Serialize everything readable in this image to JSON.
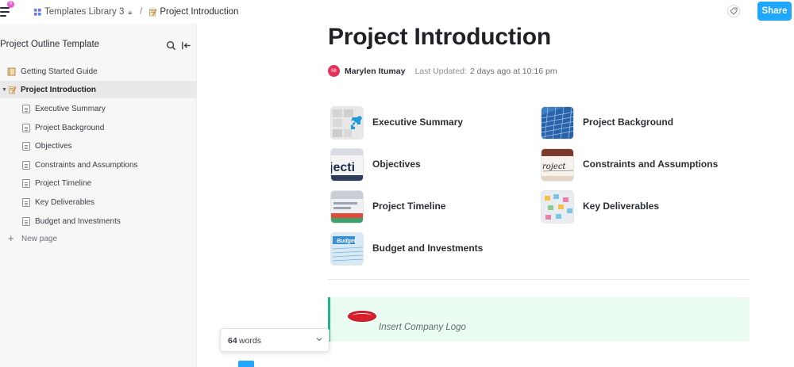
{
  "topbar": {
    "notification_count": "8",
    "breadcrumb": {
      "library_label": "Templates Library 3",
      "separator": "/",
      "page_label": "Project Introduction"
    },
    "share_label": "Share"
  },
  "sidebar": {
    "title": "Project Outline Template",
    "items": [
      {
        "label": "Getting Started Guide",
        "icon": "notebook-emoji-icon"
      },
      {
        "label": "Project Introduction",
        "icon": "memo-emoji-icon",
        "active": true
      },
      {
        "label": "Executive Summary",
        "icon": "doc-icon"
      },
      {
        "label": "Project Background",
        "icon": "doc-icon"
      },
      {
        "label": "Objectives",
        "icon": "doc-icon"
      },
      {
        "label": "Constraints and Assumptions",
        "icon": "doc-icon"
      },
      {
        "label": "Project Timeline",
        "icon": "doc-icon"
      },
      {
        "label": "Key Deliverables",
        "icon": "doc-icon"
      },
      {
        "label": "Budget and Investments",
        "icon": "doc-icon"
      }
    ],
    "new_page_label": "New page"
  },
  "main": {
    "title": "Project Introduction",
    "author": {
      "initials": "MI",
      "name": "Marylen Itumay",
      "updated_label": "Last Updated:",
      "updated_value": "2 days ago at 10:16 pm"
    },
    "cards": [
      {
        "label": "Executive Summary"
      },
      {
        "label": "Project Background"
      },
      {
        "label": "Objectives"
      },
      {
        "label": "Constraints and Assumptions"
      },
      {
        "label": "Project Timeline"
      },
      {
        "label": "Key Deliverables"
      },
      {
        "label": "Budget and Investments"
      }
    ],
    "thumb_text": {
      "objectives": "jecti",
      "constraints": "roject",
      "budget": "Budget"
    },
    "callout": {
      "logo_text": "Peterbilt",
      "text": "Insert Company Logo"
    }
  },
  "word_count": {
    "count": "64",
    "label": "words"
  },
  "colors": {
    "accent": "#1ea7fd",
    "avatar": "#e8315a",
    "callout_bg": "#eafbf2",
    "callout_border": "#1db58d"
  }
}
